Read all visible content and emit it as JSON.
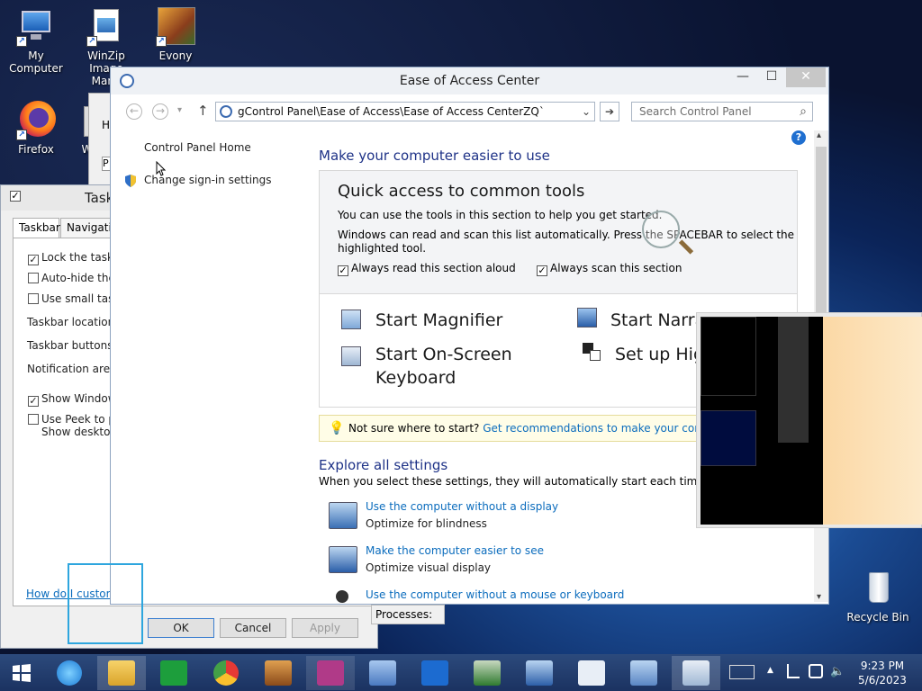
{
  "desktop": {
    "icons": [
      {
        "name": "my-computer",
        "label": "My Computer"
      },
      {
        "name": "winzip",
        "label": "WinZip Image Mana..."
      },
      {
        "name": "evony",
        "label": "Evony"
      },
      {
        "name": "firefox",
        "label": "Firefox"
      },
      {
        "name": "partial",
        "label": "Wi"
      },
      {
        "name": "recycle-bin",
        "label": "Recycle Bin"
      }
    ],
    "shortcut_arrow": "↗"
  },
  "taskbar_props": {
    "title": "Task",
    "tabs": [
      "Taskbar",
      "Navigation"
    ],
    "options": [
      {
        "label": "Lock the taskbar",
        "checked": true,
        "check": "✓"
      },
      {
        "label": "Auto-hide the ta",
        "checked": false,
        "check": ""
      },
      {
        "label": "Use small taskba",
        "checked": false,
        "check": ""
      },
      {
        "label": "Taskbar location on",
        "checked": null
      },
      {
        "label": "Taskbar buttons:",
        "checked": null
      },
      {
        "label": "Notification area:",
        "checked": null
      },
      {
        "label": "Show Windows S",
        "checked": true,
        "check": "✓"
      },
      {
        "label": "Use Peek to prev",
        "label2": "Show desktop bu",
        "checked": false,
        "check": ""
      }
    ],
    "help_link": "How do I customize",
    "ok": "OK",
    "cancel": "Cancel",
    "apply": "Apply",
    "processes": "Processes:"
  },
  "ease_window": {
    "title": "Ease of Access Center",
    "address": "gControl Panel\\Ease of Access\\Ease of Access CenterZQ`",
    "search_placeholder": "Search Control Panel",
    "nav": {
      "back": "←",
      "forward": "→",
      "recent": "▾",
      "up": "↑",
      "addr_drop": "⌄",
      "go": "➔",
      "search_icon": "⌕"
    },
    "left_links": [
      "Control Panel Home",
      "Change sign-in settings"
    ],
    "heading": "Make your computer easier to use",
    "quick_title": "Quick access to common tools",
    "quick_line1": "You can use the tools in this section to help you get started.",
    "quick_line2": "Windows can read and scan this list automatically.  Press the SPACEBAR to select the",
    "quick_line3": "highlighted tool.",
    "check_read": "Always read this section aloud",
    "check_scan": "Always scan this section",
    "check_mark": "✓",
    "tools": {
      "magnifier": "Start Magnifier",
      "narrator": "Start Narra",
      "osk1": "Start On-Screen",
      "osk2": "Keyboard",
      "high": "Set up Hig"
    },
    "tip_static": "Not sure where to start?",
    "tip_link": "Get recommendations to make your computer ea",
    "explore_title": "Explore all settings",
    "explore_desc": "When you select these settings, they will automatically start each time you sign",
    "settings": [
      {
        "link": "Use the computer without a display",
        "desc": "Optimize for blindness"
      },
      {
        "link": "Make the computer easier to see",
        "desc": "Optimize visual display"
      },
      {
        "link": "Use the computer without a mouse or keyboard",
        "desc": ""
      }
    ],
    "help_glyph": "?",
    "scroll_up": "▴",
    "scroll_down": "▾",
    "title_btns": {
      "minimize": "—",
      "maximize": "☐",
      "close": "✕"
    }
  },
  "taskbar": {
    "time": "9:23 PM",
    "date": "5/6/2023",
    "tray_up": "▲"
  },
  "colors": {
    "link": "#0b6cbd",
    "heading": "#1e3287",
    "selection_box": "#2ea6de"
  }
}
